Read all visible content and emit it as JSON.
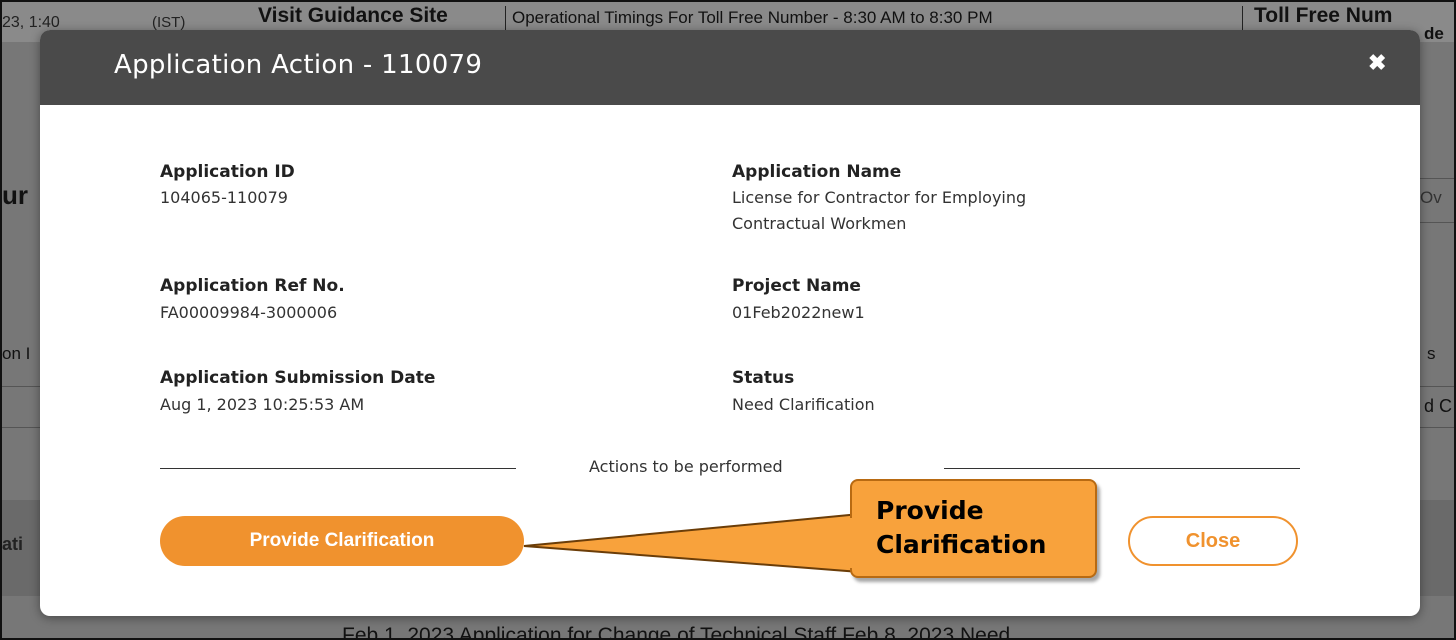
{
  "background": {
    "top_partial_left": "23, 1:40",
    "top_partial_ist": "(IST)",
    "visit_guidance": "Visit Guidance Site",
    "operational_timings": "Operational Timings For Toll Free Number - 8:30 AM to 8:30 PM",
    "toll_free": "Toll Free Num",
    "toll_free_2": "de",
    "left_fragment_1": "ur",
    "left_fragment_2": "on I",
    "left_fragment_3": "ati",
    "right_fragment_1": "Ov",
    "right_fragment_2": "s",
    "right_fragment_3": "d C",
    "bottom_row": "Feb 1, 2023      Application for Change of Technical Staff      Feb 8, 2023      Need"
  },
  "modal": {
    "title": "Application Action - 110079",
    "close_icon": "close-icon",
    "fields": {
      "application_id_label": "Application ID",
      "application_id_value": "104065-110079",
      "application_name_label": "Application Name",
      "application_name_value_line1": "License for Contractor for Employing",
      "application_name_value_line2": "Contractual Workmen",
      "ref_no_label": "Application Ref No.",
      "ref_no_value": "FA00009984-3000006",
      "project_name_label": "Project Name",
      "project_name_value": "01Feb2022new1",
      "submission_date_label": "Application Submission Date",
      "submission_date_value": "Aug 1, 2023 10:25:53 AM",
      "status_label": "Status",
      "status_value": "Need Clarification"
    },
    "actions_heading": "Actions to be performed",
    "provide_button": "Provide Clarification",
    "close_button": "Close"
  },
  "callout": {
    "line1": "Provide",
    "line2": "Clarification"
  },
  "colors": {
    "accent": "#f0922e",
    "header_bg": "#4a4a4a",
    "callout_bg": "#f8a23c"
  }
}
